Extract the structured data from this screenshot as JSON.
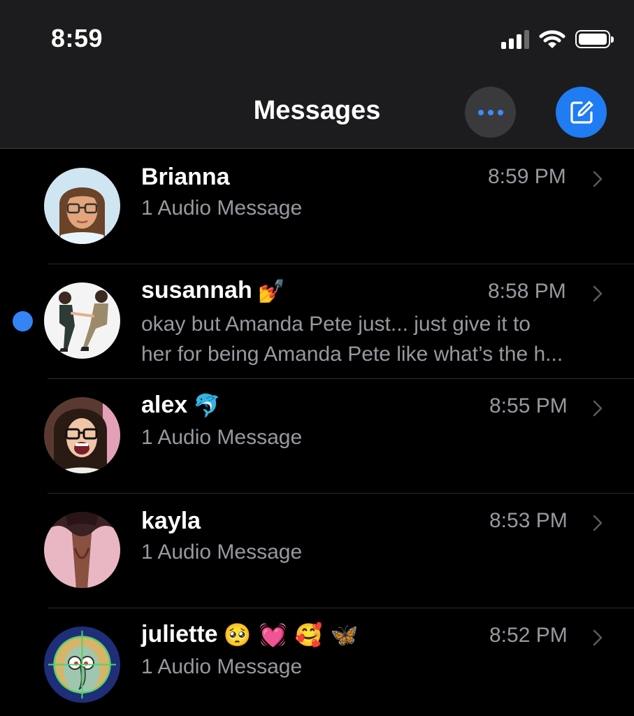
{
  "status_bar": {
    "time": "8:59"
  },
  "header": {
    "title": "Messages"
  },
  "conversations": [
    {
      "name": "Brianna",
      "emoji": "",
      "time": "8:59 PM",
      "preview": [
        "1 Audio Message"
      ],
      "unread": false
    },
    {
      "name": "susannah",
      "emoji": "💅",
      "time": "8:58 PM",
      "preview": [
        "okay but Amanda Pete just... just give it to",
        "her for being Amanda Pete like what’s the h..."
      ],
      "unread": true
    },
    {
      "name": "alex",
      "emoji": "🐬",
      "time": "8:55 PM",
      "preview": [
        "1 Audio Message"
      ],
      "unread": false
    },
    {
      "name": "kayla",
      "emoji": "",
      "time": "8:53 PM",
      "preview": [
        "1 Audio Message"
      ],
      "unread": false
    },
    {
      "name": "juliette",
      "emoji": "🥺 💓 🥰 🦋",
      "time": "8:52 PM",
      "preview": [
        "1 Audio Message"
      ],
      "unread": false
    }
  ],
  "colors": {
    "accent": "#1f7cf2",
    "unread": "#3584f5",
    "background": "#000000",
    "bar": "#1c1c1e",
    "secondary_text": "#98989f"
  },
  "icons": [
    "signal-icon",
    "wifi-icon",
    "battery-icon",
    "more-icon",
    "compose-icon",
    "chevron-right-icon"
  ]
}
